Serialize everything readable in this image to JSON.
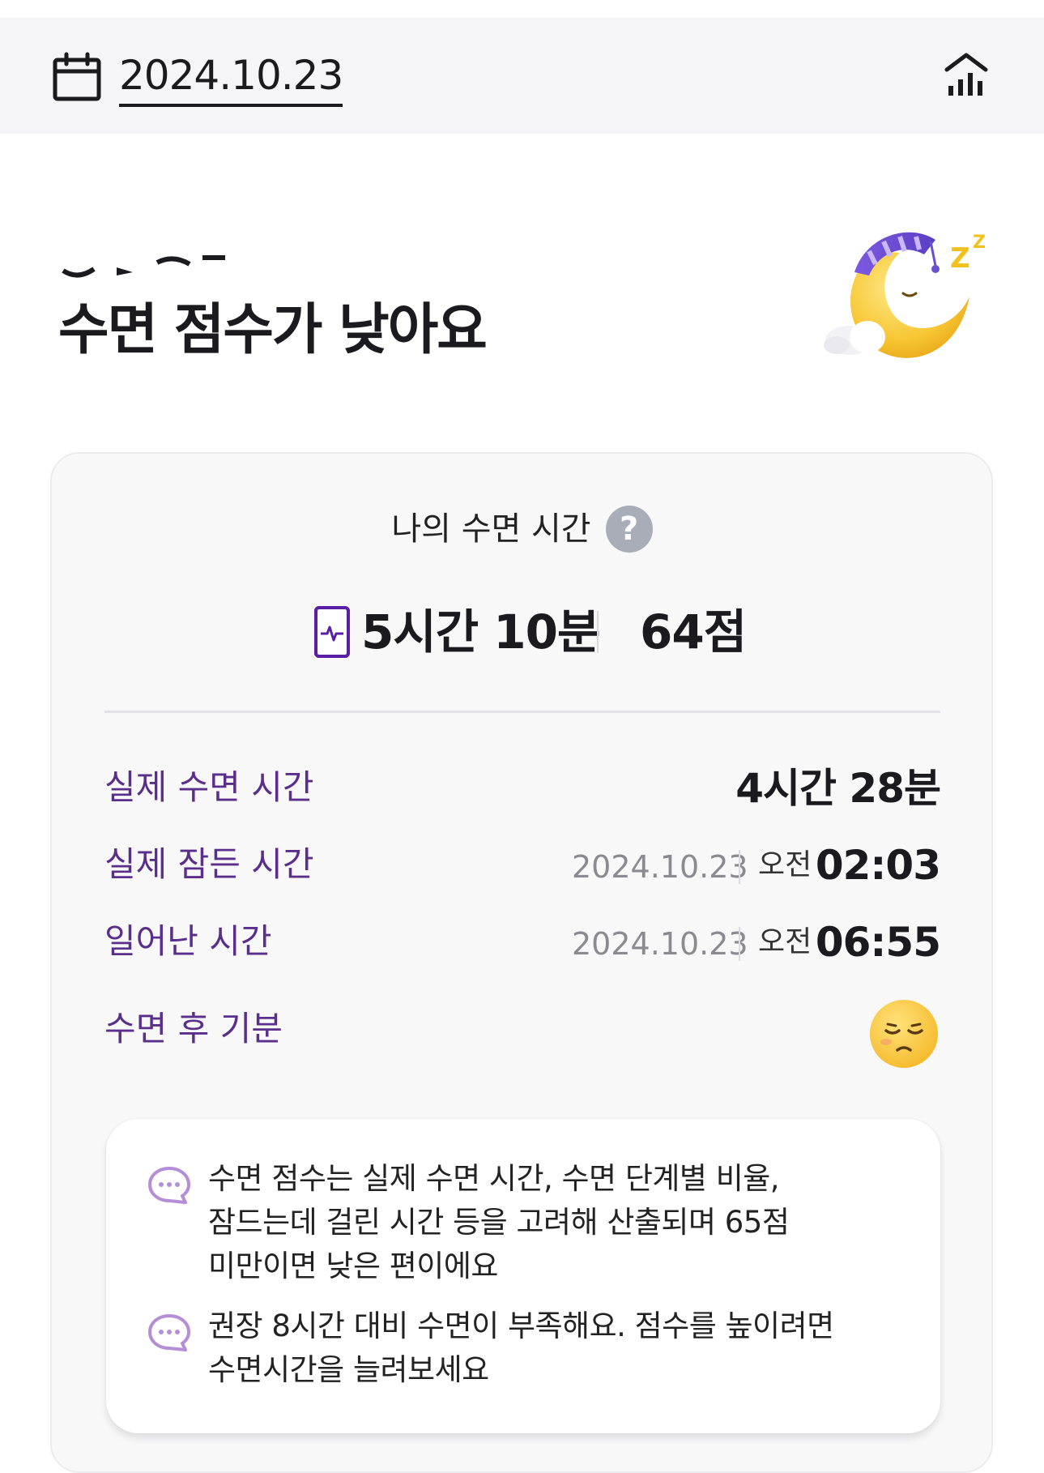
{
  "header": {
    "date": "2024.10.23",
    "calendar_icon": "calendar-icon",
    "stats_icon": "bar-chart-icon"
  },
  "headline": "수면 점수가 낮아요",
  "illustration": "sleeping-moon-with-nightcap",
  "card": {
    "title": "나의 수면 시간",
    "help_icon": "?",
    "device_icon": "phone-heartbeat-icon",
    "duration": "5시간 10분",
    "score": "64점",
    "rows": {
      "actual_sleep": {
        "label": "실제 수면 시간",
        "value": "4시간 28분"
      },
      "fell_asleep": {
        "label": "실제 잠든 시간",
        "date": "2024.10.23",
        "ampm": "오전",
        "time": "02:03"
      },
      "woke_up": {
        "label": "일어난 시간",
        "date": "2024.10.23",
        "ampm": "오전",
        "time": "06:55"
      },
      "mood": {
        "label": "수면 후 기분",
        "icon": "tired-face-emoji"
      }
    }
  },
  "tips": [
    {
      "icon": "chat-bubble-icon",
      "text": "수면 점수는 실제 수면 시간, 수면 단계별 비율,\n잠드는데 걸린 시간 등을 고려해 산출되며 65점\n미만이면 낮은 편이에요"
    },
    {
      "icon": "chat-bubble-icon",
      "text": "권장 8시간 대비 수면이 부족해요. 점수를 높이려면\n수면시간을 늘려보세요"
    }
  ],
  "colors": {
    "accent_purple": "#5a2f8c",
    "device_purple": "#5b1fa6",
    "tip_icon_purple": "#b48fd8"
  }
}
